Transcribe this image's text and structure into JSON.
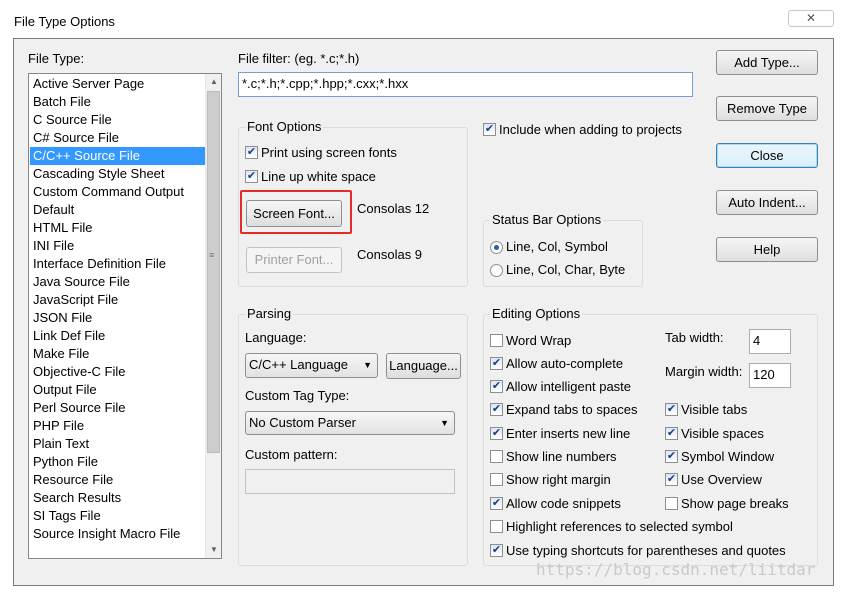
{
  "window": {
    "title": "File Type Options",
    "close_glyph": "✕"
  },
  "file_type": {
    "label": "File Type:",
    "items": [
      "Active Server Page",
      "Batch File",
      "C Source File",
      "C# Source File",
      "C/C++ Source File",
      "Cascading Style Sheet",
      "Custom Command Output",
      "Default",
      "HTML File",
      "INI File",
      "Interface Definition File",
      "Java Source File",
      "JavaScript File",
      "JSON File",
      "Link Def File",
      "Make File",
      "Objective-C File",
      "Output File",
      "Perl Source File",
      "PHP File",
      "Plain Text",
      "Python File",
      "Resource File",
      "Search Results",
      "SI Tags File",
      "Source Insight Macro File"
    ],
    "selected": "C/C++ Source File"
  },
  "file_filter": {
    "label": "File filter: (eg. *.c;*.h)",
    "value": "*.c;*.h;*.cpp;*.hpp;*.cxx;*.hxx"
  },
  "include_projects": {
    "label": "Include when adding to projects",
    "checked": true
  },
  "font_options": {
    "title": "Font Options",
    "print_screen_fonts": {
      "label": "Print using screen fonts",
      "checked": true
    },
    "line_up_white_space": {
      "label": "Line up white space",
      "checked": true
    },
    "screen_font_button": "Screen Font...",
    "screen_font_value": "Consolas 12",
    "printer_font_button": "Printer Font...",
    "printer_font_value": "Consolas 9"
  },
  "status_bar": {
    "title": "Status Bar Options",
    "options": [
      "Line, Col, Symbol",
      "Line, Col, Char, Byte"
    ],
    "selected": "Line, Col, Symbol"
  },
  "parsing": {
    "title": "Parsing",
    "language_label": "Language:",
    "language_value": "C/C++ Language",
    "language_button": "Language...",
    "custom_tag_label": "Custom Tag Type:",
    "custom_tag_value": "No Custom Parser",
    "custom_pattern_label": "Custom pattern:",
    "custom_pattern_value": ""
  },
  "editing": {
    "title": "Editing Options",
    "left": [
      {
        "label": "Word Wrap",
        "checked": false
      },
      {
        "label": "Allow auto-complete",
        "checked": true
      },
      {
        "label": "Allow intelligent paste",
        "checked": true
      },
      {
        "label": "Expand tabs to spaces",
        "checked": true
      },
      {
        "label": "Enter inserts new line",
        "checked": true
      },
      {
        "label": "Show line numbers",
        "checked": false
      },
      {
        "label": "Show right margin",
        "checked": false
      },
      {
        "label": "Allow code snippets",
        "checked": true
      },
      {
        "label": "Highlight references to selected symbol",
        "checked": false
      },
      {
        "label": "Use typing shortcuts for parentheses and quotes",
        "checked": true
      }
    ],
    "right": [
      {
        "label": "Visible tabs",
        "checked": true
      },
      {
        "label": "Visible spaces",
        "checked": true
      },
      {
        "label": "Symbol Window",
        "checked": true
      },
      {
        "label": "Use Overview",
        "checked": true
      },
      {
        "label": "Show page breaks",
        "checked": false
      }
    ],
    "tab_width_label": "Tab width:",
    "tab_width_value": "4",
    "margin_width_label": "Margin width:",
    "margin_width_value": "120"
  },
  "buttons": {
    "add_type": "Add Type...",
    "remove_type": "Remove Type",
    "close": "Close",
    "auto_indent": "Auto Indent...",
    "help": "Help"
  },
  "glyphs": {
    "check": "✔",
    "dropdown": "▼",
    "scroll_up": "▲",
    "scroll_down": "▼",
    "grip": "≡"
  },
  "watermark": "https://blog.csdn.net/liitdar"
}
